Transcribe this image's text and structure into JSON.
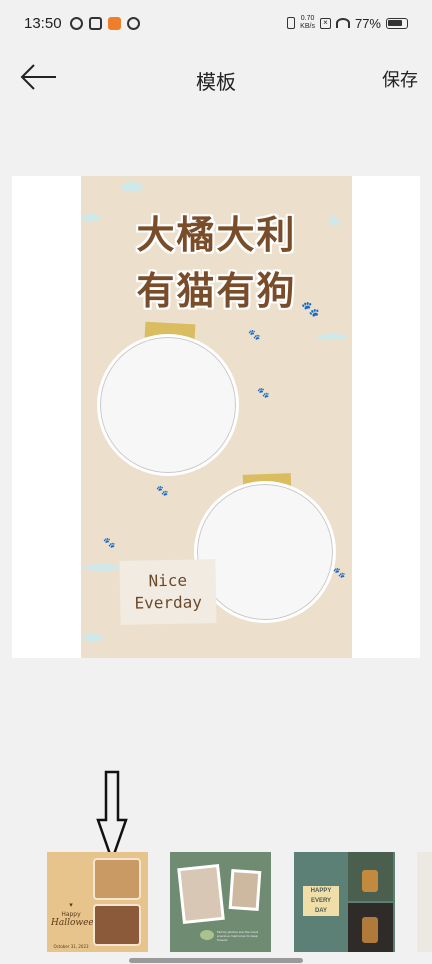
{
  "status_bar": {
    "time": "13:50",
    "net_speed_value": "0.70",
    "net_speed_unit": "KB/s",
    "battery": "77%"
  },
  "header": {
    "title": "模板",
    "save_label": "保存",
    "back_icon": "arrow-left-icon"
  },
  "poster": {
    "title_line1": "大橘大利",
    "title_line2": "有猫有狗",
    "note_line1": "Nice",
    "note_line2": "Everday",
    "background_color": "#ecdfcc",
    "title_color": "#7a4d2a"
  },
  "thumbnails": [
    {
      "name": "halloween-template",
      "text_happy": "Happy",
      "text_title": "Halloween",
      "text_date": "October 31, 2023",
      "background_color": "#e7c48b"
    },
    {
      "name": "family-photo-template",
      "text_caption": "Family photos are the most precious memories to keep forever",
      "background_color": "#6f8b71"
    },
    {
      "name": "happy-every-day-template",
      "text_line1": "HAPPY",
      "text_line2": "EVERY",
      "text_line3": "DAY",
      "background_color": "#5c7f76"
    },
    {
      "name": "partial-template",
      "background_color": "#ece8e2"
    }
  ]
}
